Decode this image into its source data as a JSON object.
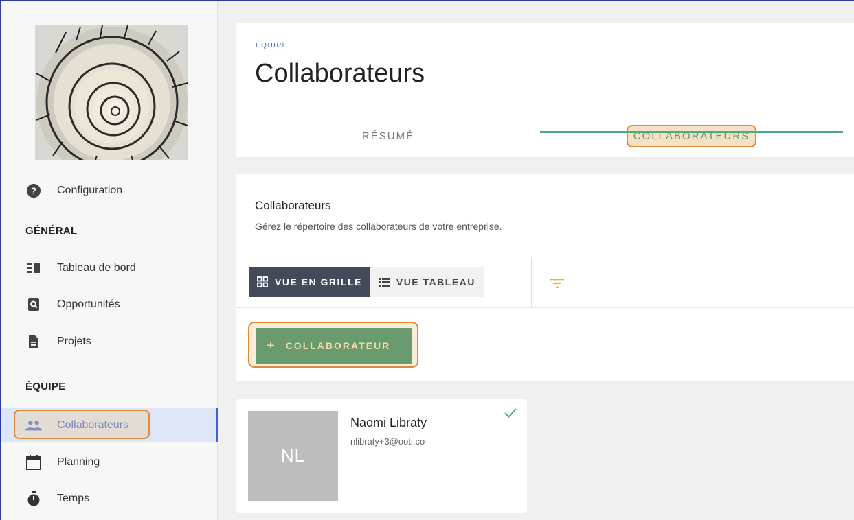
{
  "sidebar": {
    "config_label": "Configuration",
    "section_general": "GÉNÉRAL",
    "section_team": "ÉQUIPE",
    "items": [
      {
        "label": "Tableau de bord",
        "icon": "dashboard-icon"
      },
      {
        "label": "Opportunités",
        "icon": "search-doc-icon"
      },
      {
        "label": "Projets",
        "icon": "document-icon"
      },
      {
        "label": "Collaborateurs",
        "icon": "people-icon",
        "active": true
      },
      {
        "label": "Planning",
        "icon": "calendar-icon"
      },
      {
        "label": "Temps",
        "icon": "stopwatch-icon"
      }
    ]
  },
  "header": {
    "eyebrow": "ÉQUIPE",
    "title": "Collaborateurs",
    "tabs": [
      {
        "label": "RÉSUMÉ",
        "active": false
      },
      {
        "label": "COLLABORATEURS",
        "active": true
      }
    ]
  },
  "section": {
    "title": "Collaborateurs",
    "subtitle": "Gérez le répertoire des collaborateurs de votre entreprise.",
    "view_grid_label": "VUE EN GRILLE",
    "view_table_label": "VUE TABLEAU",
    "add_label": "COLLABORATEUR",
    "add_plus": "+"
  },
  "people": [
    {
      "initials": "NL",
      "name": "Naomi Libraty",
      "email": "nlibraty+3@ooti.co",
      "verified": true
    }
  ],
  "colors": {
    "accent_blue": "#3d63d4",
    "accent_green": "#4bab82",
    "button_green": "#6a9b6e",
    "highlight_orange": "#e08a3a"
  }
}
